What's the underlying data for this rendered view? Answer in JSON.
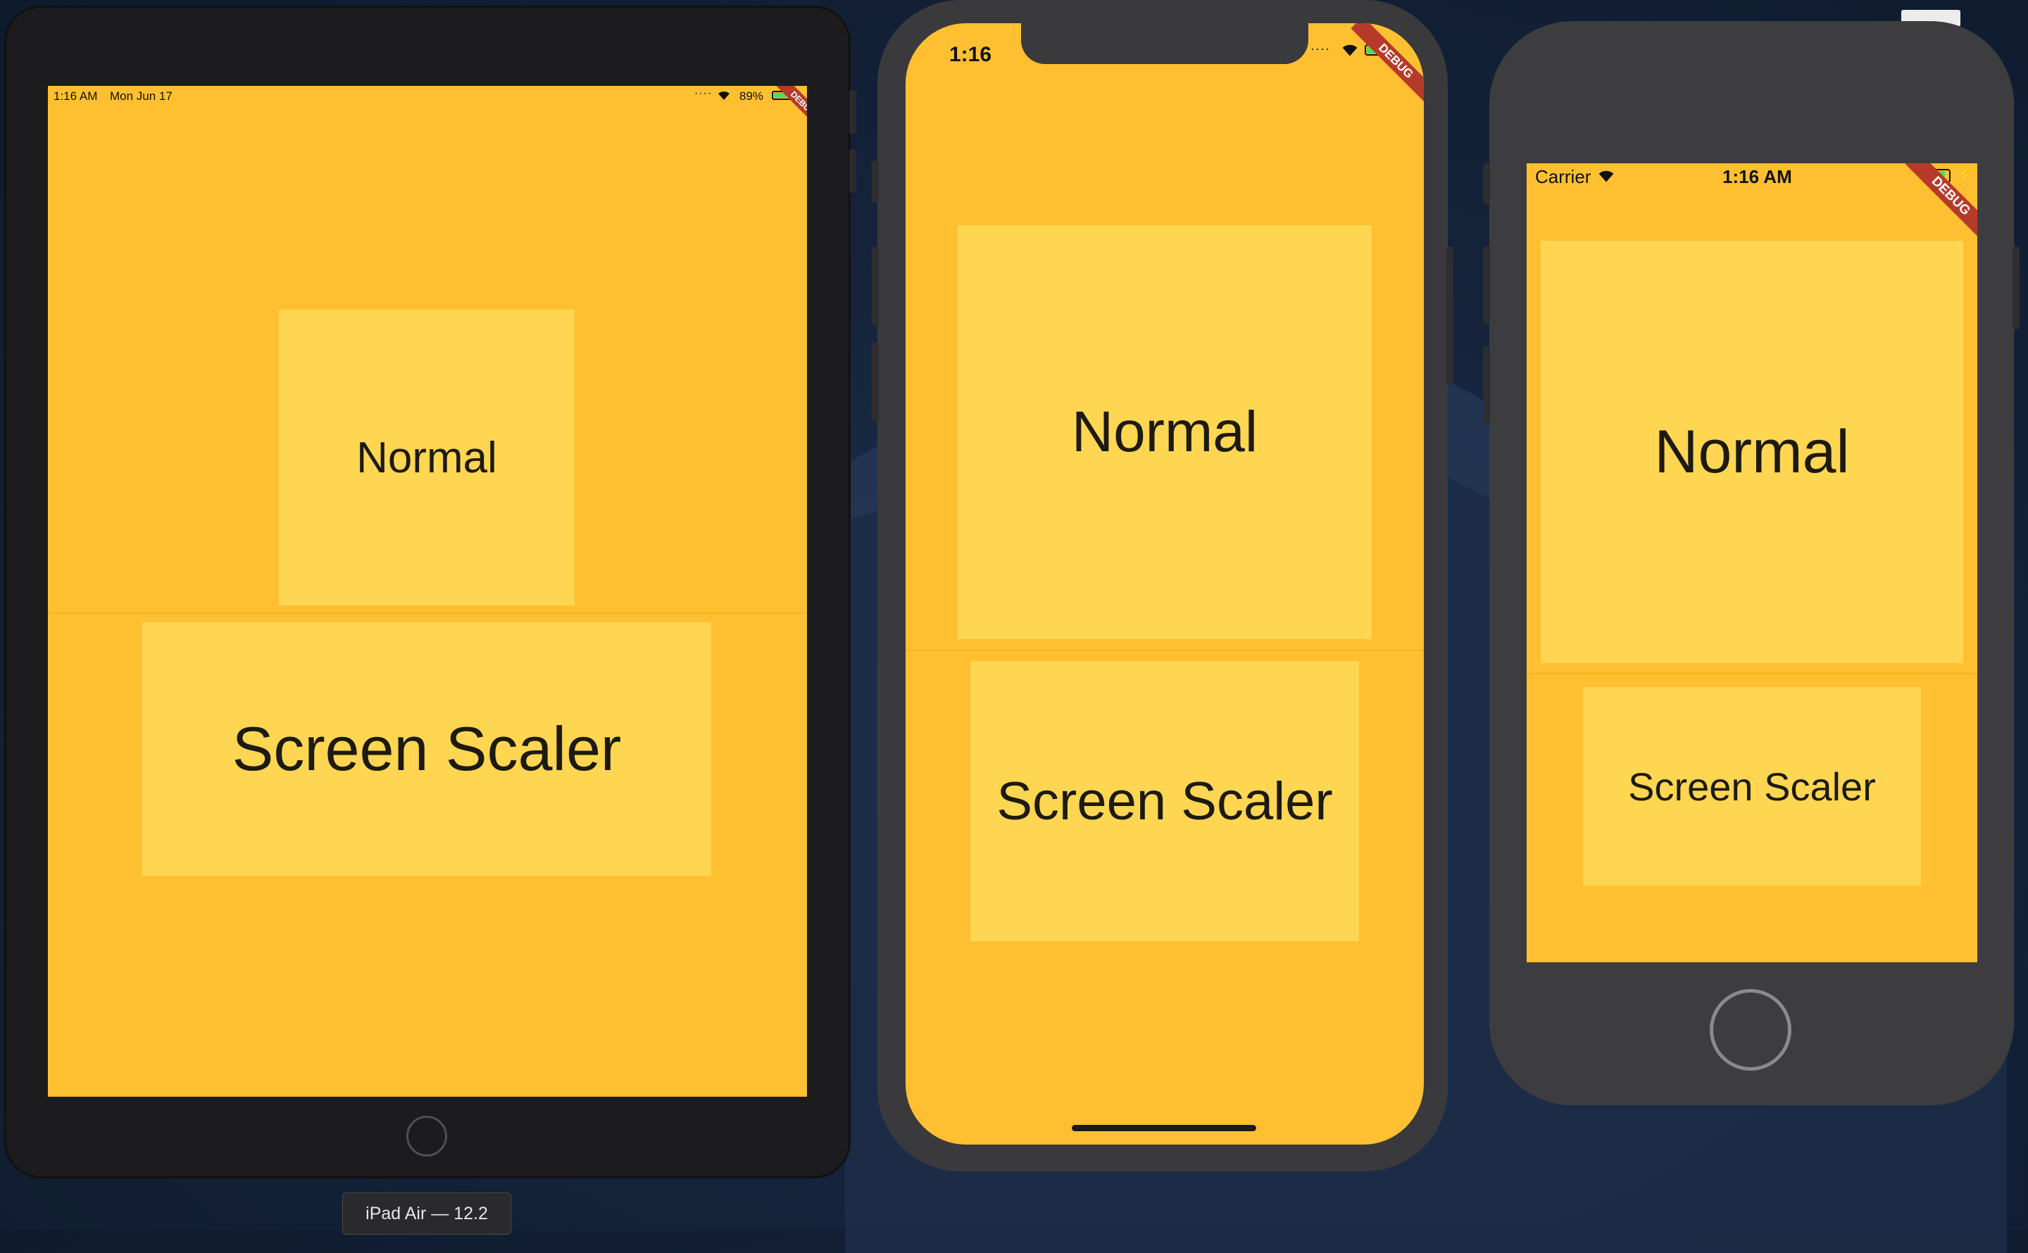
{
  "colors": {
    "app_background": "#fec030",
    "card": "#ffd651",
    "text": "#1d1a12",
    "debug_banner": "#b63a2a",
    "battery": "#4cd964"
  },
  "ipad": {
    "status": {
      "time": "1:16 AM",
      "date": "Mon Jun 17",
      "battery_pct": "89%"
    },
    "normal_label": "Normal",
    "scaler_label": "Screen Scaler",
    "debug_label": "DEBUG",
    "tooltip": "iPad Air — 12.2"
  },
  "iphone_x": {
    "status": {
      "time": "1:16"
    },
    "normal_label": "Normal",
    "scaler_label": "Screen Scaler",
    "debug_label": "DEBUG"
  },
  "iphone_8": {
    "status": {
      "carrier": "Carrier",
      "time": "1:16 AM"
    },
    "normal_label": "Normal",
    "scaler_label": "Screen Scaler",
    "debug_label": "DEBUG"
  },
  "icons": [
    "wifi-icon",
    "battery-icon",
    "signal-dots-icon",
    "charging-bolt-icon",
    "home-button-icon"
  ]
}
